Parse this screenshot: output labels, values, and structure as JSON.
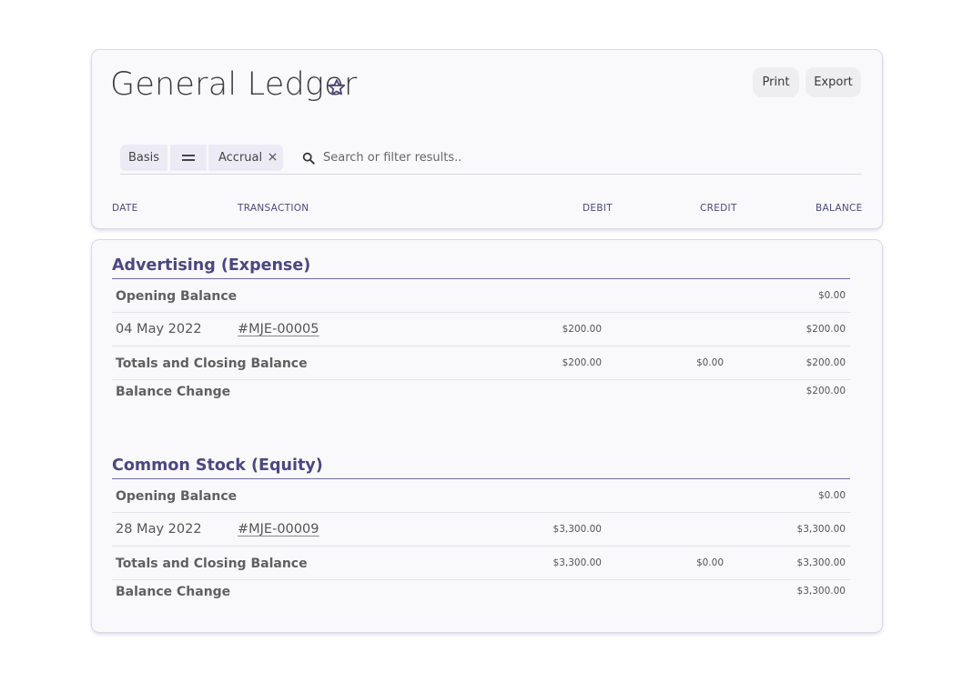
{
  "header": {
    "title": "General Ledger",
    "print_label": "Print",
    "export_label": "Export"
  },
  "filter": {
    "field": "Basis",
    "value": "Accrual",
    "search_placeholder": "Search or filter results.."
  },
  "columns": {
    "date": "DATE",
    "transaction": "TRANSACTION",
    "debit": "DEBIT",
    "credit": "CREDIT",
    "balance": "BALANCE"
  },
  "sections": [
    {
      "title": "Advertising (Expense)",
      "opening_label": "Opening Balance",
      "opening_balance": "$0.00",
      "entry": {
        "date": "04 May 2022",
        "ref": "#MJE-00005",
        "debit": "$200.00",
        "balance": "$200.00"
      },
      "totals_label": "Totals and Closing Balance",
      "totals": {
        "debit": "$200.00",
        "credit": "$0.00",
        "balance": "$200.00"
      },
      "change_label": "Balance Change",
      "change": "$200.00"
    },
    {
      "title": "Common Stock (Equity)",
      "opening_label": "Opening Balance",
      "opening_balance": "$0.00",
      "entry": {
        "date": "28 May 2022",
        "ref": "#MJE-00009",
        "debit": "$3,300.00",
        "balance": "$3,300.00"
      },
      "totals_label": "Totals and Closing Balance",
      "totals": {
        "debit": "$3,300.00",
        "credit": "$0.00",
        "balance": "$3,300.00"
      },
      "change_label": "Balance Change",
      "change": "$3,300.00"
    }
  ],
  "icons": {
    "favorite": "star-icon",
    "operator": "equals-icon",
    "remove_filter": "close-icon",
    "search": "search-icon"
  },
  "colors": {
    "accent": "#4b4781",
    "column_header": "#4e4a80",
    "chip": "#ecebf5",
    "card_background": "#f9f9fb"
  }
}
